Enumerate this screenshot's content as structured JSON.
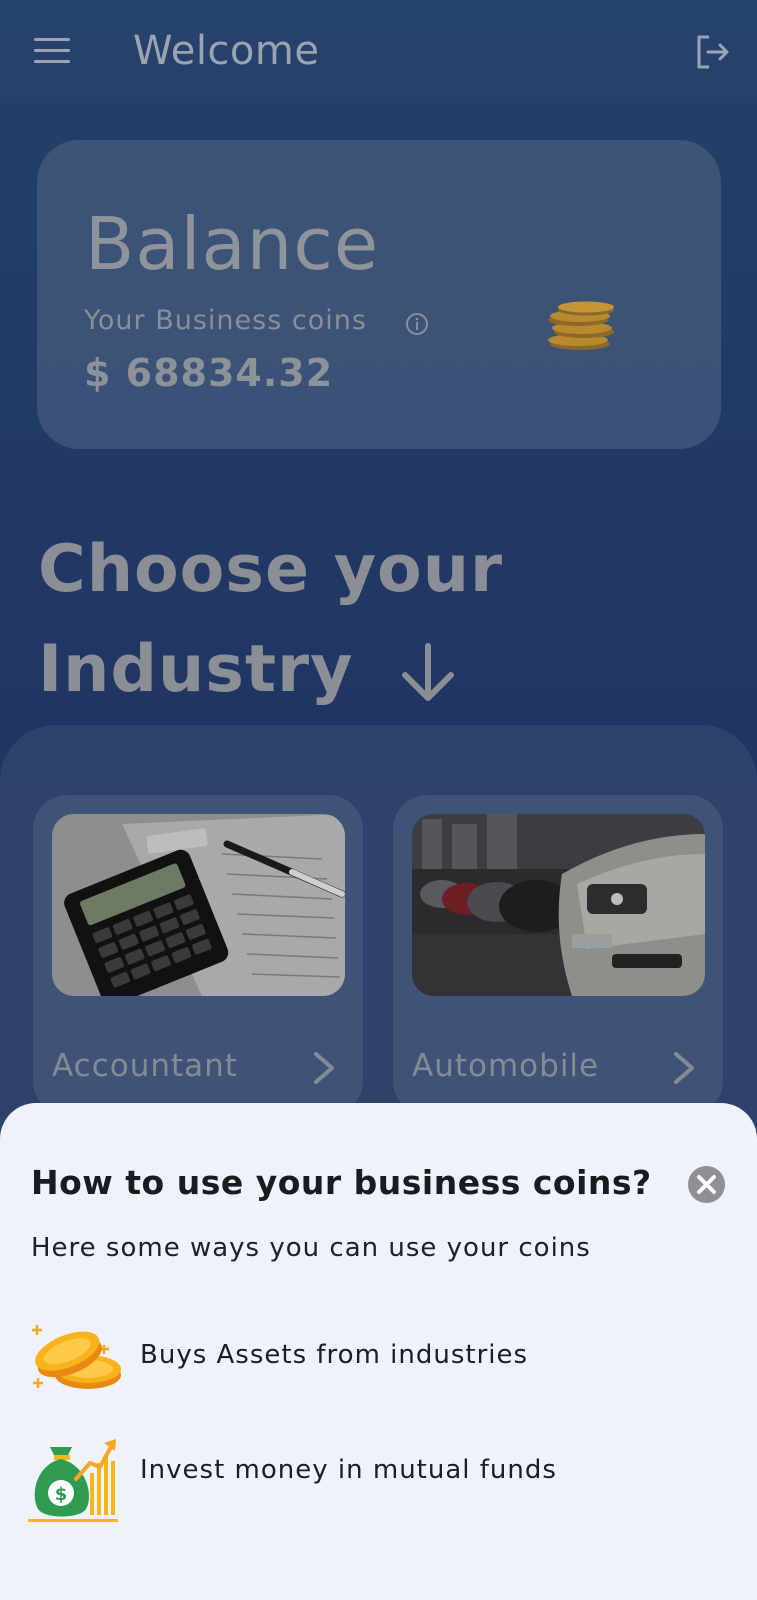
{
  "header": {
    "title": "Welcome",
    "menu_icon": "hamburger-menu-icon",
    "logout_icon": "logout-icon"
  },
  "balance": {
    "title": "Balance",
    "subtitle": "Your Business coins",
    "amount": "$ 68834.32",
    "info_icon": "info-icon",
    "coins_icon": "coin-stack-icon"
  },
  "industry_section": {
    "heading_line1": "Choose your",
    "heading_line2": "Industry",
    "arrow_icon": "arrow-down-icon"
  },
  "industries": [
    {
      "label": "Accountant"
    },
    {
      "label": "Automobile"
    }
  ],
  "sheet": {
    "title": "How to use your business coins?",
    "subtitle": "Here some ways you can use your coins",
    "items": [
      {
        "label": "Buys Assets from industries",
        "icon": "gold-coins-icon"
      },
      {
        "label": "Invest money in mutual funds",
        "icon": "money-bag-growth-icon"
      }
    ]
  },
  "colors": {
    "background": "#203563",
    "sheet_background": "#eff1fb",
    "coin_gold": "#f5a623",
    "money_green": "#2e9b4f"
  }
}
